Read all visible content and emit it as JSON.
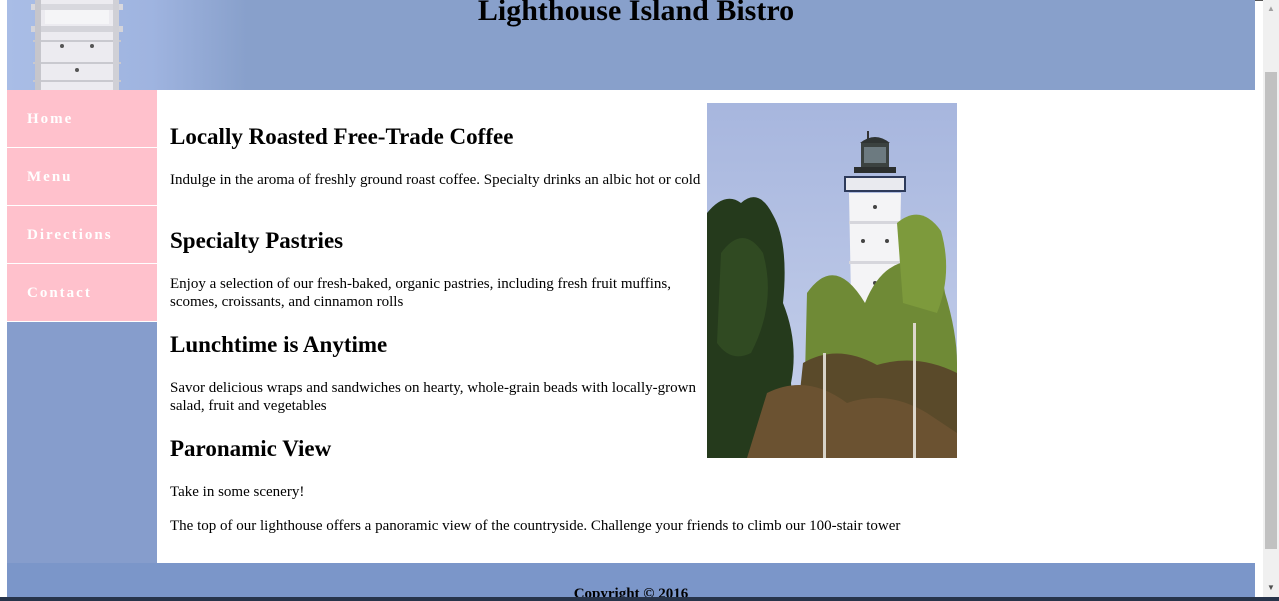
{
  "site": {
    "title": "Lighthouse Island Bistro"
  },
  "nav": {
    "items": [
      {
        "label": "Home"
      },
      {
        "label": "Menu"
      },
      {
        "label": "Directions"
      },
      {
        "label": "Contact"
      }
    ]
  },
  "main": {
    "sections": [
      {
        "heading": "Locally Roasted Free-Trade Coffee",
        "text": "Indulge in the aroma of freshly ground roast coffee. Specialty drinks an albic hot or cold"
      },
      {
        "heading": "Specialty Pastries",
        "text": "Enjoy a selection of our fresh-baked, organic pastries, including fresh fruit muffins, scomes, croissants, and cinnamon rolls"
      },
      {
        "heading": "Lunchtime is Anytime",
        "text": "Savor delicious wraps and sandwiches on hearty, whole-grain beads with locally-grown salad, fruit and vegetables"
      },
      {
        "heading": "Paronamic View",
        "text": "Take in some scenery!",
        "text2": "The top of our lighthouse offers a panoramic view of the countryside. Challenge your friends to climb our 100-stair tower"
      }
    ]
  },
  "footer": {
    "copyright": "Copyright © 2016"
  },
  "colors": {
    "header_bg": "#88a0cb",
    "nav_bg": "#ffc1cc",
    "sidebar_bg": "#869dcc",
    "footer_bg": "#7b96c9"
  },
  "icons": {
    "scroll_up": "scroll-up-arrow-icon",
    "scroll_down": "scroll-down-arrow-icon"
  }
}
